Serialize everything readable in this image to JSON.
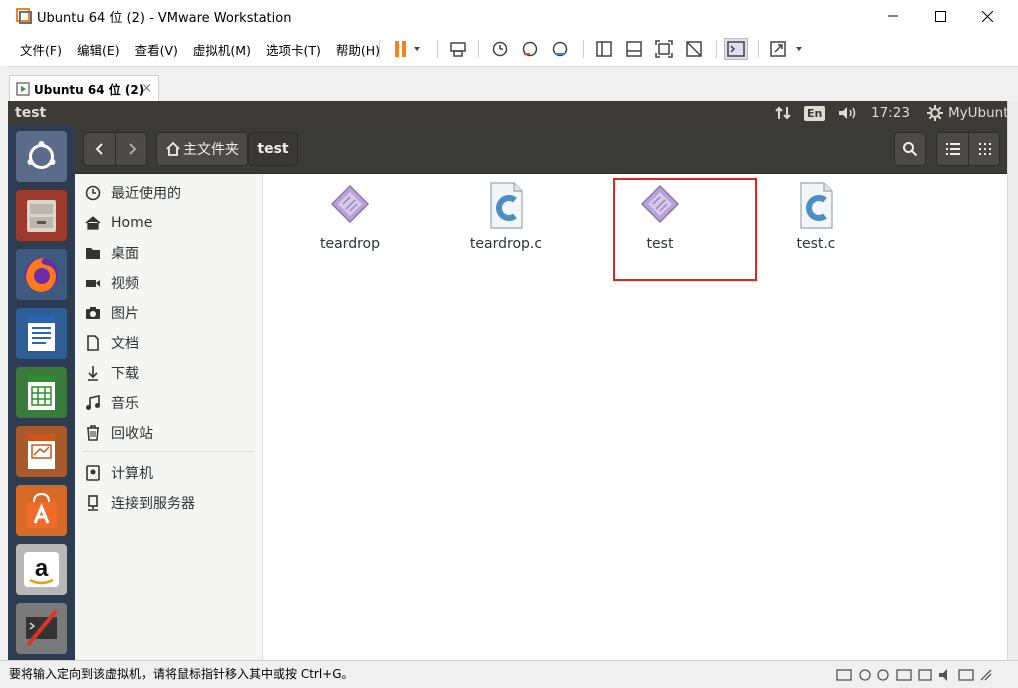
{
  "window": {
    "title": "Ubuntu 64 位 (2) - VMware Workstation",
    "controls": [
      "minimize",
      "maximize",
      "close"
    ]
  },
  "menubar": {
    "items": [
      "文件(F)",
      "编辑(E)",
      "查看(V)",
      "虚拟机(M)",
      "选项卡(T)",
      "帮助(H)"
    ]
  },
  "tab": {
    "label": "Ubuntu 64 位 (2)",
    "close": "×"
  },
  "ubuntu_panel": {
    "window_title": "test",
    "keyboard": "En",
    "time": "17:23",
    "user": "MyUbunt"
  },
  "nautilus": {
    "path": [
      "主文件夹",
      "test"
    ],
    "sidebar": [
      {
        "label": "最近使用的",
        "icon": "clock-icon"
      },
      {
        "label": "Home",
        "icon": "home-icon"
      },
      {
        "label": "桌面",
        "icon": "folder-icon"
      },
      {
        "label": "视频",
        "icon": "video-icon"
      },
      {
        "label": "图片",
        "icon": "camera-icon"
      },
      {
        "label": "文档",
        "icon": "document-icon"
      },
      {
        "label": "下载",
        "icon": "download-icon"
      },
      {
        "label": "音乐",
        "icon": "music-icon"
      },
      {
        "label": "回收站",
        "icon": "trash-icon"
      },
      {
        "label": "计算机",
        "icon": "computer-icon"
      },
      {
        "label": "连接到服务器",
        "icon": "server-icon"
      }
    ],
    "files": [
      {
        "name": "teardrop",
        "type": "executable"
      },
      {
        "name": "teardrop.c",
        "type": "c-source"
      },
      {
        "name": "test",
        "type": "executable",
        "highlighted": true
      },
      {
        "name": "test.c",
        "type": "c-source"
      }
    ]
  },
  "statusbar": {
    "text": "要将输入定向到该虚拟机，请将鼠标指针移入其中或按 Ctrl+G。"
  },
  "colors": {
    "panel": "#3c3b37",
    "launcher": "#2e3c52",
    "highlight": "#e02424",
    "accent": "#f58220"
  }
}
